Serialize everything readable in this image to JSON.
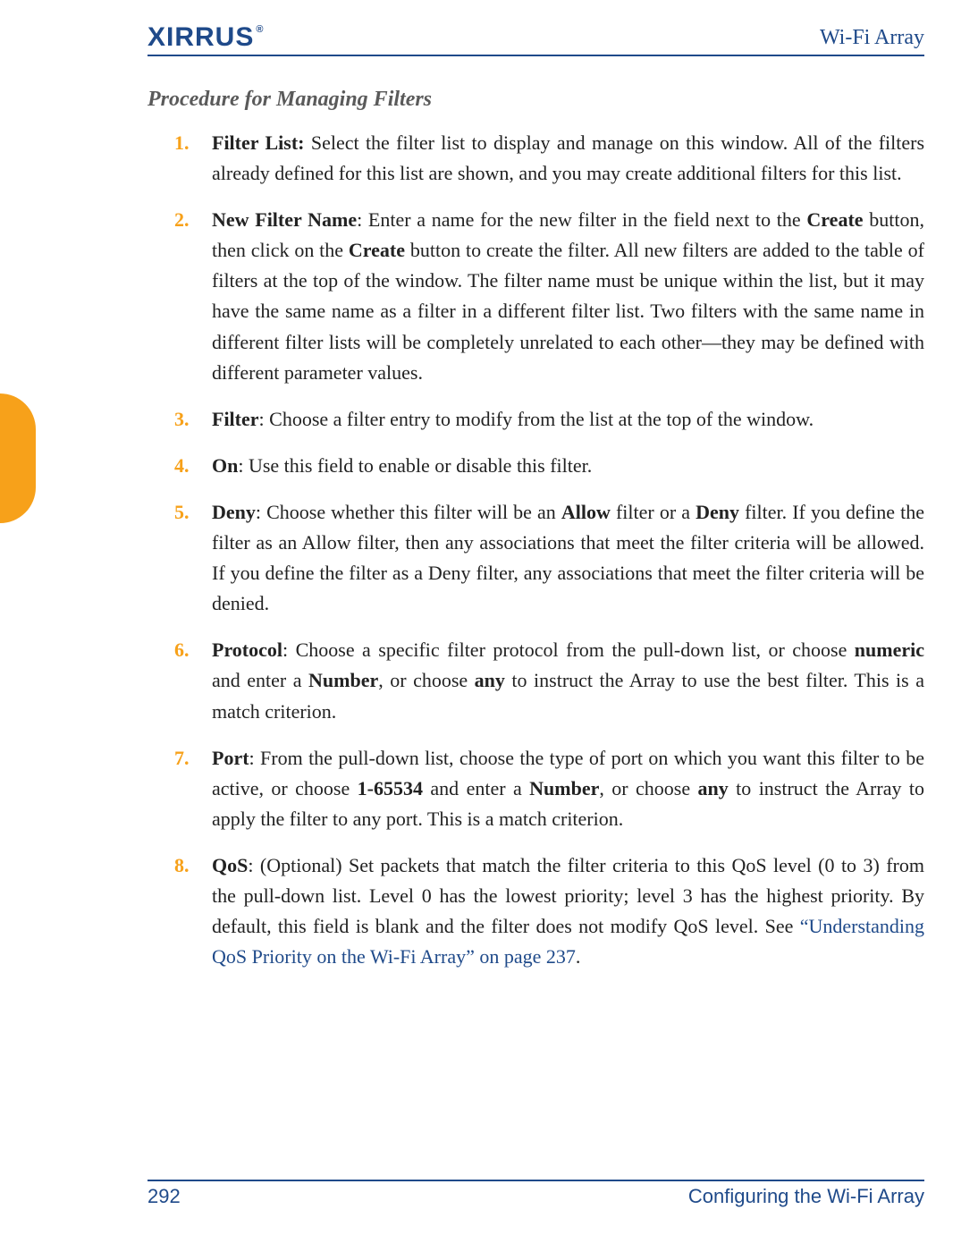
{
  "header": {
    "logo_text": "XIRRUS",
    "logo_reg": "®",
    "doc_title": "Wi-Fi Array"
  },
  "section_title": "Procedure for Managing Filters",
  "items": [
    {
      "num": "1.",
      "lead": "Filter List:",
      "rest": " Select the filter list to display and manage on this window. All of the filters already defined for this list are shown, and you may create additional filters for this list."
    },
    {
      "num": "2.",
      "lead": "New Filter Name",
      "rest_a": ": Enter a name for the new filter in the field next to the ",
      "bold_a": "Create",
      "rest_b": " button, then click on the ",
      "bold_b": "Create",
      "rest_c": " button to create the filter. All new filters are added to the table of filters at the top of the window. The filter name must be unique within the list, but it may have the same name as a filter in a different filter list. Two filters with the same name in different filter lists will be completely unrelated to each other—they may be defined with different parameter values."
    },
    {
      "num": "3.",
      "lead": "Filter",
      "rest": ": Choose a filter entry to modify from the list at the top of the window."
    },
    {
      "num": "4.",
      "lead": "On",
      "rest": ": Use this field to enable or disable this filter."
    },
    {
      "num": "5.",
      "lead": "Deny",
      "rest_a": ": Choose whether this filter will be an ",
      "bold_a": "Allow",
      "rest_b": " filter or a ",
      "bold_b": "Deny",
      "rest_c": " filter. If you define the filter as an Allow filter, then any associations that meet the filter criteria will be allowed. If you define the filter as a Deny filter, any associations that meet the filter criteria will be denied."
    },
    {
      "num": "6.",
      "lead": "Protocol",
      "rest_a": ": Choose a specific filter protocol from the pull-down list, or choose ",
      "bold_a": "numeric",
      "rest_b": " and enter a ",
      "bold_b": "Number",
      "rest_c": ", or choose ",
      "bold_c": "any",
      "rest_d": " to instruct the Array to use the best filter. This is a match criterion."
    },
    {
      "num": "7.",
      "lead": "Port",
      "rest_a": ": From the pull-down list, choose the type of port on which you want this filter to be active, or choose ",
      "bold_a": "1-65534",
      "rest_b": " and enter a ",
      "bold_b": "Number",
      "rest_c": ", or choose ",
      "bold_c": "any",
      "rest_d": " to instruct the Array to apply the filter to any port. This is a match criterion."
    },
    {
      "num": "8.",
      "lead": "QoS",
      "rest_a": ": (Optional) Set packets that match the filter criteria to this QoS level (0 to 3) from the pull-down list. Level 0 has the lowest priority; level 3 has the highest priority. By default, this field is blank and the filter does not modify QoS level. See ",
      "link": "“Understanding QoS Priority on the Wi-Fi Array” on page 237",
      "rest_b": "."
    }
  ],
  "footer": {
    "page_num": "292",
    "section": "Configuring the Wi-Fi Array"
  }
}
